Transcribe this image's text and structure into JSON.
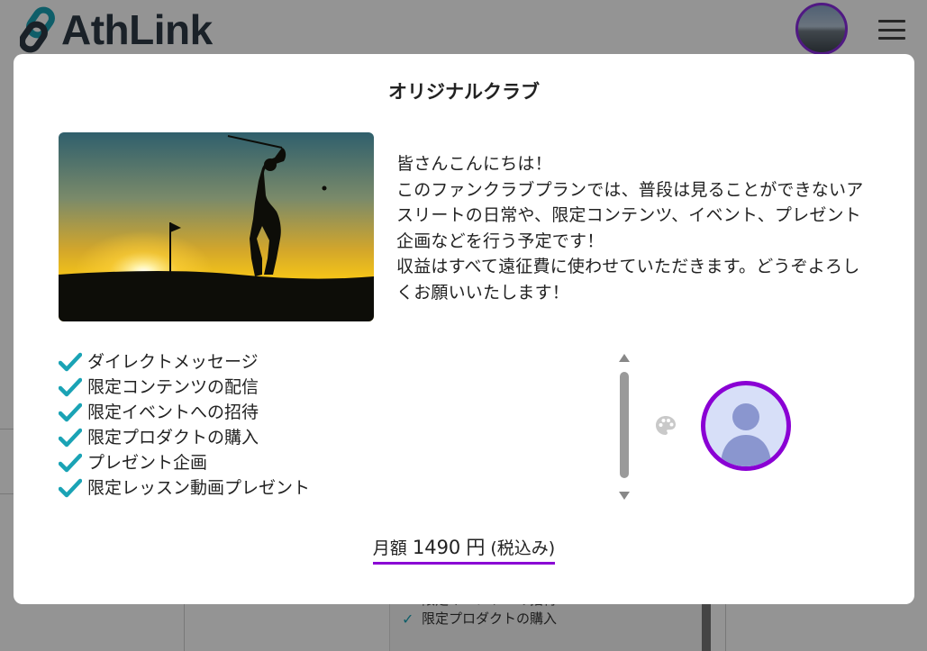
{
  "app": {
    "logo_text": "AthLink",
    "brand_color": "#1aa3b5"
  },
  "modal": {
    "title": "オリジナルクラブ",
    "description": [
      "皆さんこんにちは！",
      "このファンクラブプランでは、普段は見ることができないアスリートの日常や、限定コンテンツ、イベント、プレゼント企画などを行う予定です！",
      "収益はすべて遠征費に使わせていただきます。どうぞよろしくお願いいたします！"
    ],
    "features": [
      "ダイレクトメッセージ",
      "限定コンテンツの配信",
      "限定イベントへの招待",
      "限定プロダクトの購入",
      "プレゼント企画",
      "限定レッスン動画プレゼント"
    ],
    "price": {
      "prefix": "月額",
      "amount": "1490",
      "currency": "円",
      "suffix": "(税込み)"
    },
    "accent_color": "#8a00d4",
    "check_color": "#1aa3b5"
  },
  "background": {
    "features_visible": [
      "限定イベントへの招待",
      "限定プロダクトの購入"
    ]
  },
  "icons": {
    "logo": "link-logo-icon",
    "menu": "hamburger-menu-icon",
    "feature_check": "check-icon",
    "palette": "palette-icon",
    "avatar": "user-avatar-icon",
    "scroll_up": "triangle-up-icon",
    "scroll_down": "triangle-down-icon"
  }
}
